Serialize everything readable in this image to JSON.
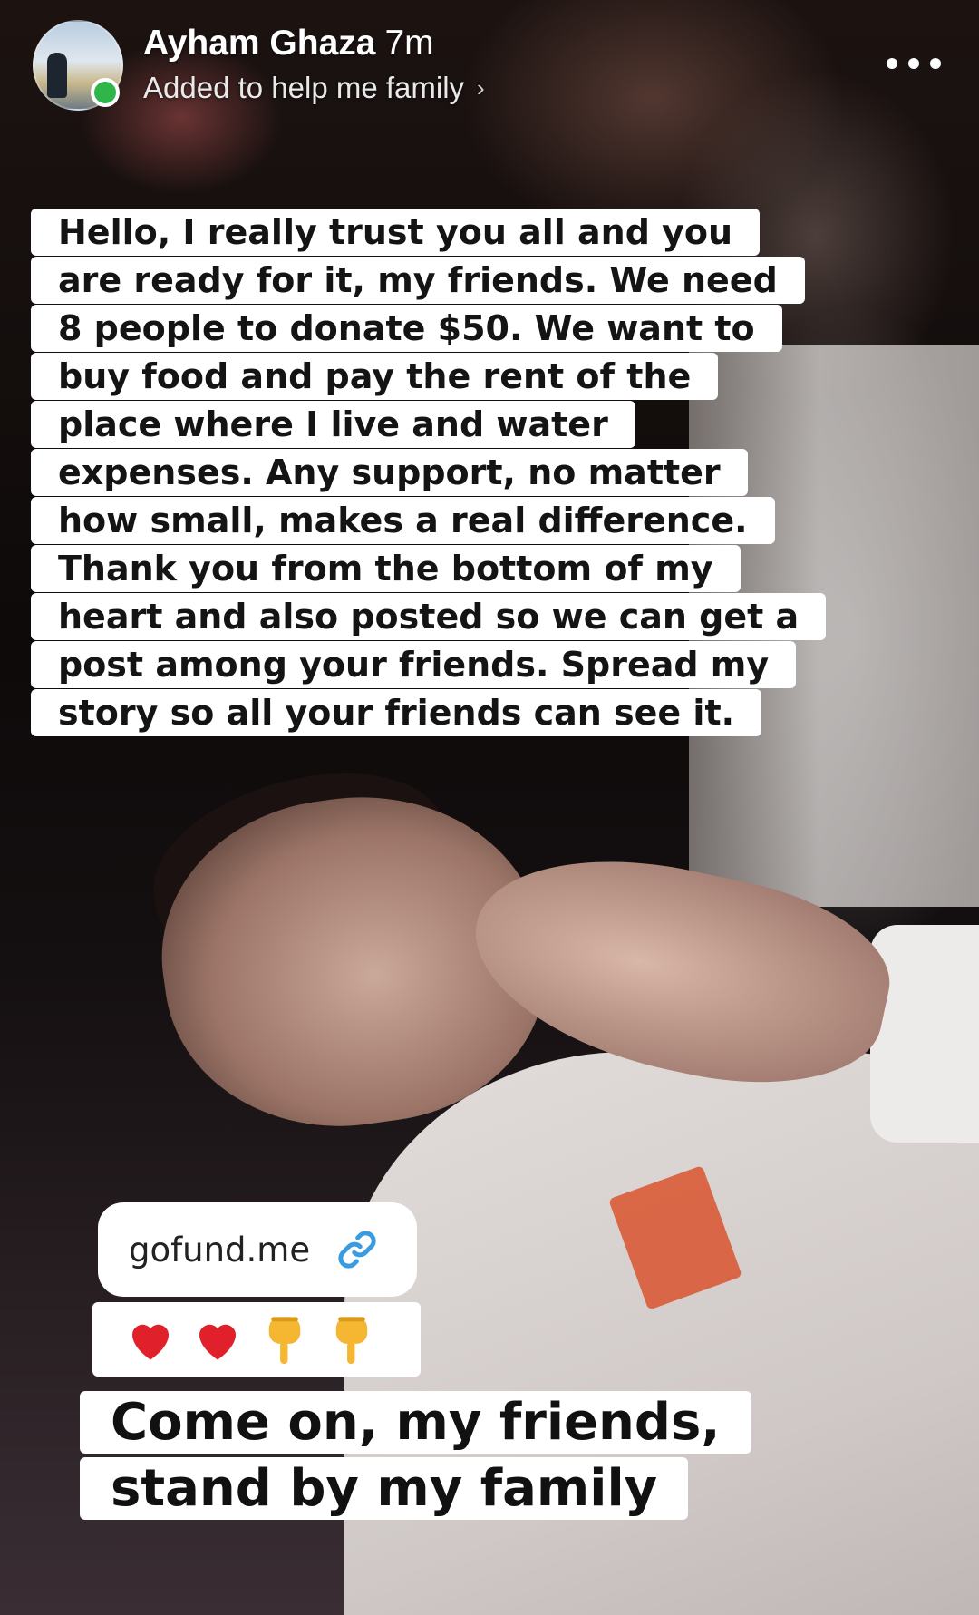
{
  "story": {
    "author": "Ayham Ghaza",
    "timestamp": "7m",
    "subtitle": "Added to help me family",
    "main_text": "Hello, I really trust you all and you are ready for it, my friends. We need 8 people to donate $50. We want to buy food and pay the rent of the place where I live and water expenses. Any support, no matter how small, makes a real difference. Thank you from the bottom of my heart and also posted so we can get a post among your friends. Spread my story so all your friends can see it.",
    "link_label": "gofund.me",
    "emojis": [
      "red-heart",
      "red-heart",
      "pointing-down",
      "pointing-down"
    ],
    "caption": "Come on, my friends, stand by my family"
  },
  "colors": {
    "online": "#2fb54a",
    "link_icon": "#3b9be0",
    "heart": "#e0202b",
    "hand": "#f5b731"
  }
}
